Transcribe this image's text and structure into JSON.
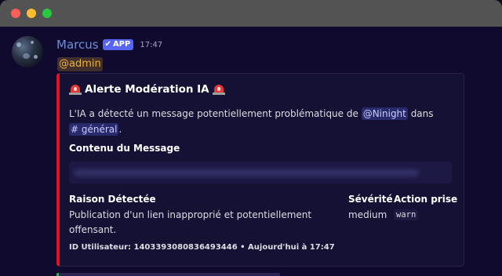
{
  "window": {
    "controls": [
      "close",
      "minimize",
      "maximize"
    ]
  },
  "message": {
    "author": "Marcus",
    "badge": "APP",
    "badge_icon": "checkmark-icon",
    "timestamp": "17:47",
    "mention": "@admin"
  },
  "embed": {
    "accent_color": "#e0131f",
    "title_icon": "rotating-light-icon",
    "title": "Alerte Modération IA",
    "description_prefix": "L'IA a détecté un message potentiellement problématique de ",
    "user_mention": "@Ninight",
    "description_mid": " dans",
    "channel_mention": "# général",
    "description_suffix": ".",
    "fields": {
      "contenu_name": "Contenu du Message",
      "raison_name": "Raison Détectée",
      "raison_value": "Publication d'un lien inapproprié et potentiellement offensant.",
      "severite_name": "Sévérité",
      "severite_value": "medium",
      "action_name": "Action prise",
      "action_value": "warn"
    },
    "footer": "ID Utilisateur: 1403393080836493446 • Aujourd'hui à 17:47"
  },
  "colors": {
    "username": "#6f8fd7",
    "app_badge": "#5865f2",
    "admin_mention": "#f0b232",
    "embed_bg": "#151135"
  }
}
